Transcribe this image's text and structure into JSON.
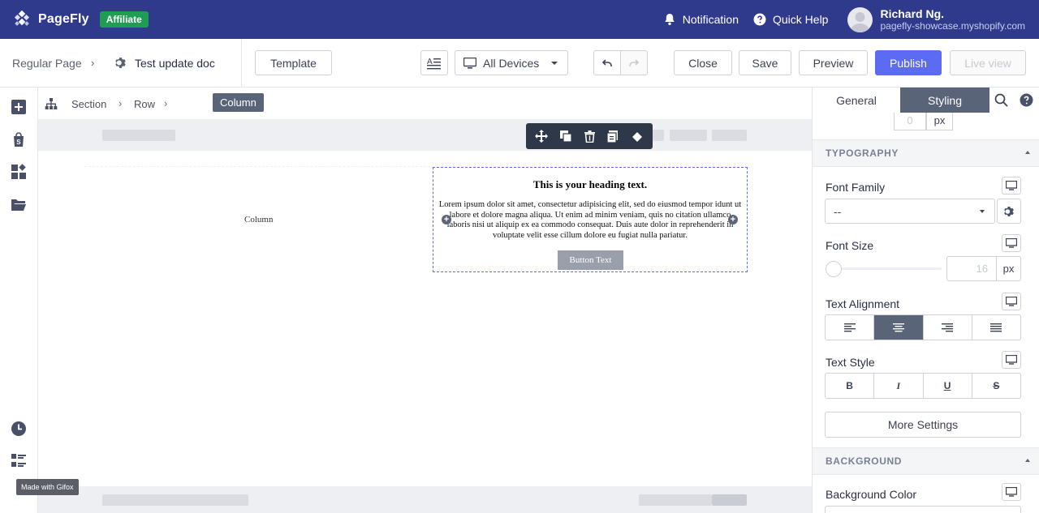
{
  "topbar": {
    "brand": "PageFly",
    "badge": "Affiliate",
    "notification": "Notification",
    "quick_help": "Quick Help",
    "user_name": "Richard Ng.",
    "user_shop": "pagefly-showcase.myshopify.com"
  },
  "toolbar": {
    "page_type": "Regular Page",
    "doc_name": "Test update doc",
    "template": "Template",
    "devices": "All Devices",
    "close": "Close",
    "save": "Save",
    "preview": "Preview",
    "publish": "Publish",
    "live_view": "Live view"
  },
  "breadcrumb": [
    "Section",
    "Row",
    "Column"
  ],
  "canvas": {
    "column_label": "Column",
    "heading": "This is your heading text.",
    "paragraph": "Lorem ipsum dolor sit amet, consectetur adipisicing elit, sed do eiusmod tempor idunt ut labore et dolore magna aliqua. Ut enim ad minim veniam, quis no citation ullamco laboris nisi ut aliquip ex ea commodo consequat. Duis aute dolor in reprehenderit in voluptate velit esse cillum dolore eu fugiat nulla pariatur.",
    "button_text": "Button Text"
  },
  "watermark": "Made with Gifox",
  "panel": {
    "tab_general": "General",
    "tab_styling": "Styling",
    "top_value": "0",
    "top_unit": "px",
    "typography_title": "TYPOGRAPHY",
    "font_family_label": "Font Family",
    "font_family_value": "--",
    "font_size_label": "Font Size",
    "font_size_value": "16",
    "font_size_unit": "px",
    "font_size_slider": 0,
    "text_alignment_label": "Text Alignment",
    "text_alignment_selected": "center",
    "text_style_label": "Text Style",
    "text_style_options": [
      "B",
      "I",
      "U",
      "S"
    ],
    "more_settings": "More Settings",
    "background_title": "BACKGROUND",
    "background_color_label": "Background Color"
  },
  "colors": {
    "topbar": "#2f3a8c",
    "accent": "#5b6cf2",
    "badge": "#1f9d55",
    "active": "#5a6478"
  }
}
